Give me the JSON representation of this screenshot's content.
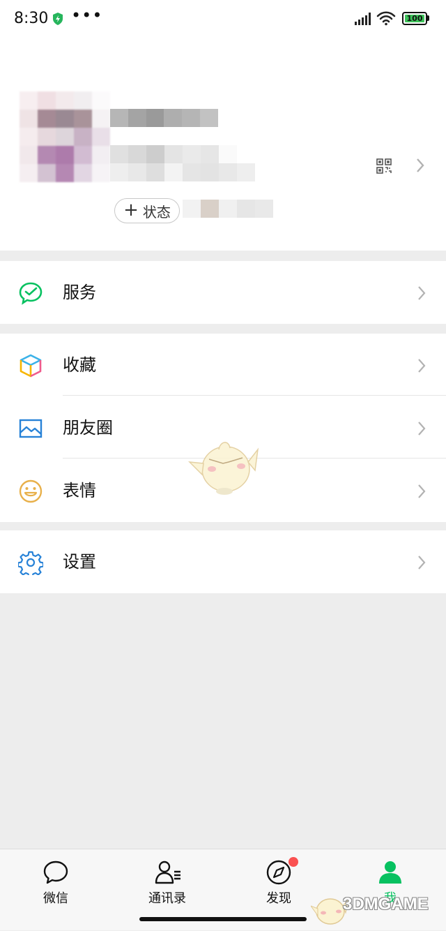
{
  "status_bar": {
    "time": "8:30",
    "more": "•••",
    "battery": "100",
    "icons": [
      "shield-icon",
      "signal-icon",
      "wifi-icon",
      "battery-icon"
    ]
  },
  "profile": {
    "status_button_label": "状态",
    "status_button_icon": "plus-icon",
    "qr_icon": "qr-code-icon",
    "name_obscured": true
  },
  "menu_groups": [
    {
      "items": [
        {
          "label": "服务",
          "icon": "wechat-pay-icon",
          "color": "#07c160"
        }
      ]
    },
    {
      "items": [
        {
          "label": "收藏",
          "icon": "favorites-cube-icon",
          "color": "#f7b500"
        },
        {
          "label": "朋友圈",
          "icon": "moments-picture-icon",
          "color": "#2782d7"
        },
        {
          "label": "表情",
          "icon": "emoji-face-icon",
          "color": "#e8b04a"
        }
      ]
    },
    {
      "items": [
        {
          "label": "设置",
          "icon": "settings-gear-icon",
          "color": "#2782d7"
        }
      ]
    }
  ],
  "tab_bar": {
    "tabs": [
      {
        "label": "微信",
        "icon": "chat-bubble-icon"
      },
      {
        "label": "通讯录",
        "icon": "contacts-icon"
      },
      {
        "label": "发现",
        "icon": "compass-icon",
        "badge": true
      },
      {
        "label": "我",
        "icon": "me-person-icon",
        "active": true
      }
    ],
    "active_color": "#07c160"
  },
  "watermark": {
    "text": "3DMGAME"
  },
  "colors": {
    "background": "#ededed",
    "accent": "#07c160",
    "badge": "#fa5151"
  }
}
